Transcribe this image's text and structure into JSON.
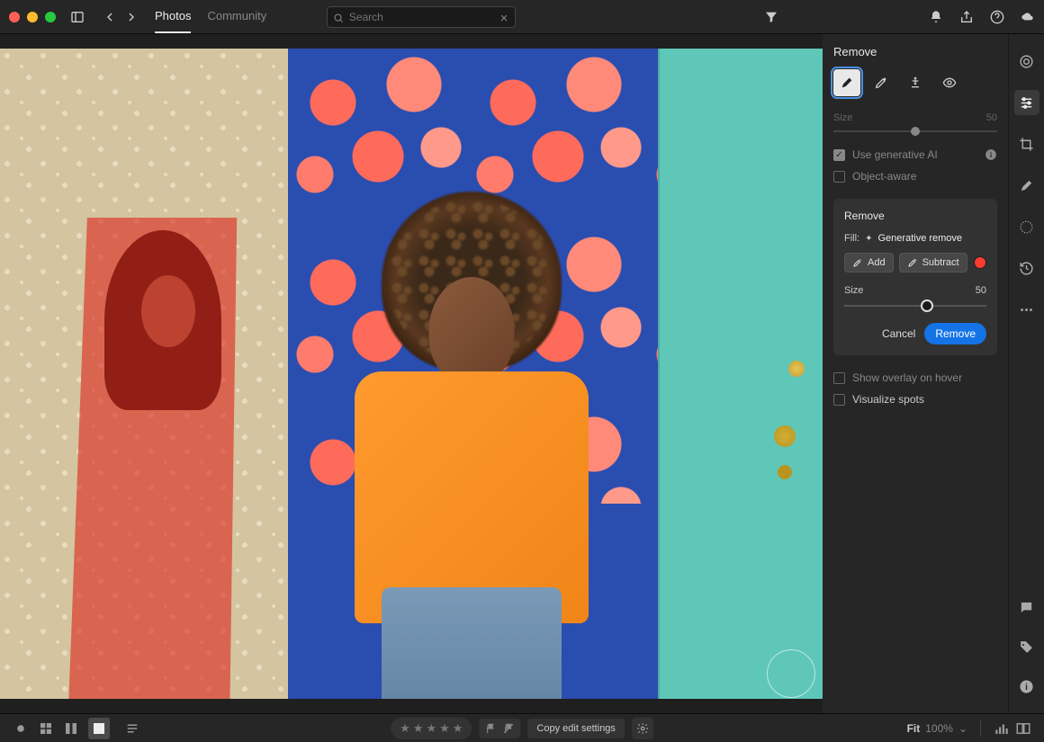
{
  "nav": {
    "photos": "Photos",
    "community": "Community"
  },
  "search": {
    "placeholder": "Search"
  },
  "panel": {
    "title": "Remove",
    "size_label": "Size",
    "size_value_dim": "50",
    "use_gen_ai": "Use generative AI",
    "object_aware": "Object-aware",
    "show_overlay": "Show overlay on hover",
    "visualize_spots": "Visualize spots"
  },
  "subpanel": {
    "title": "Remove",
    "fill_label": "Fill:",
    "fill_value": "Generative remove",
    "add": "Add",
    "subtract": "Subtract",
    "size_label": "Size",
    "size_value": "50",
    "cancel": "Cancel",
    "remove": "Remove"
  },
  "bottom": {
    "copy": "Copy edit settings",
    "fit": "Fit",
    "zoom": "100%"
  }
}
